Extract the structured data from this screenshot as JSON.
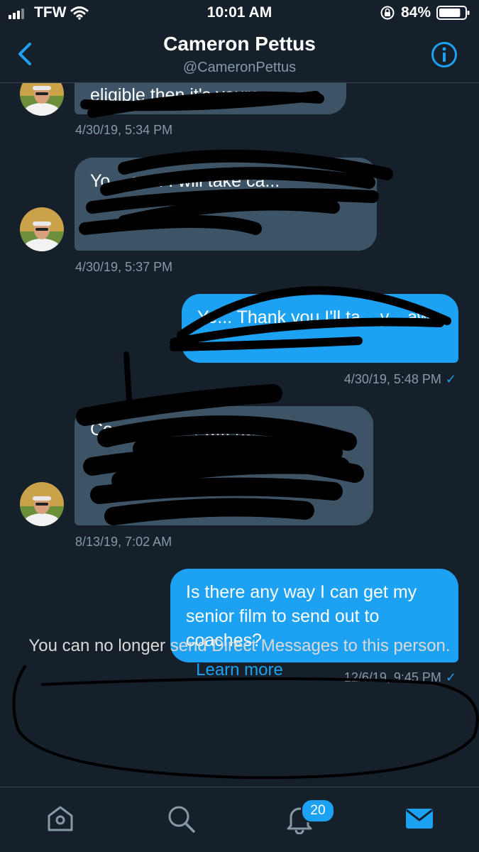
{
  "status_bar": {
    "carrier": "TFW",
    "time": "10:01 AM",
    "battery": "84%",
    "battery_level": 0.84
  },
  "header": {
    "name": "Cameron Pettus",
    "handle": "@CameronPettus"
  },
  "messages": [
    {
      "from": "them",
      "text": "eligible then it's yours",
      "timestamp": "4/30/19, 5:34 PM"
    },
    {
      "from": "them",
      "text": "Yo... ca... I will take ca...",
      "timestamp": "4/30/19, 5:37 PM"
    },
    {
      "from": "me",
      "text": "Ye... Thank you I'll ta... y... awl",
      "timestamp": "4/30/19, 5:48 PM"
    },
    {
      "from": "them",
      "text": "Co... school. I w... ha... is... s.",
      "timestamp": "8/13/19, 7:02 AM"
    },
    {
      "from": "me",
      "text": "Is there any way I can get my senior film to send out to coaches?",
      "timestamp": "12/6/19, 9:45 PM"
    }
  ],
  "read_mark": "✓",
  "notice": {
    "text": "You can no longer send Direct Messages to this person.",
    "link": "Learn more"
  },
  "tab_bar": {
    "notifications_badge": "20"
  },
  "colors": {
    "background": "#15202b",
    "accent": "#1da1f2",
    "incoming_bubble": "#3d5466",
    "muted_text": "#8899a6"
  }
}
